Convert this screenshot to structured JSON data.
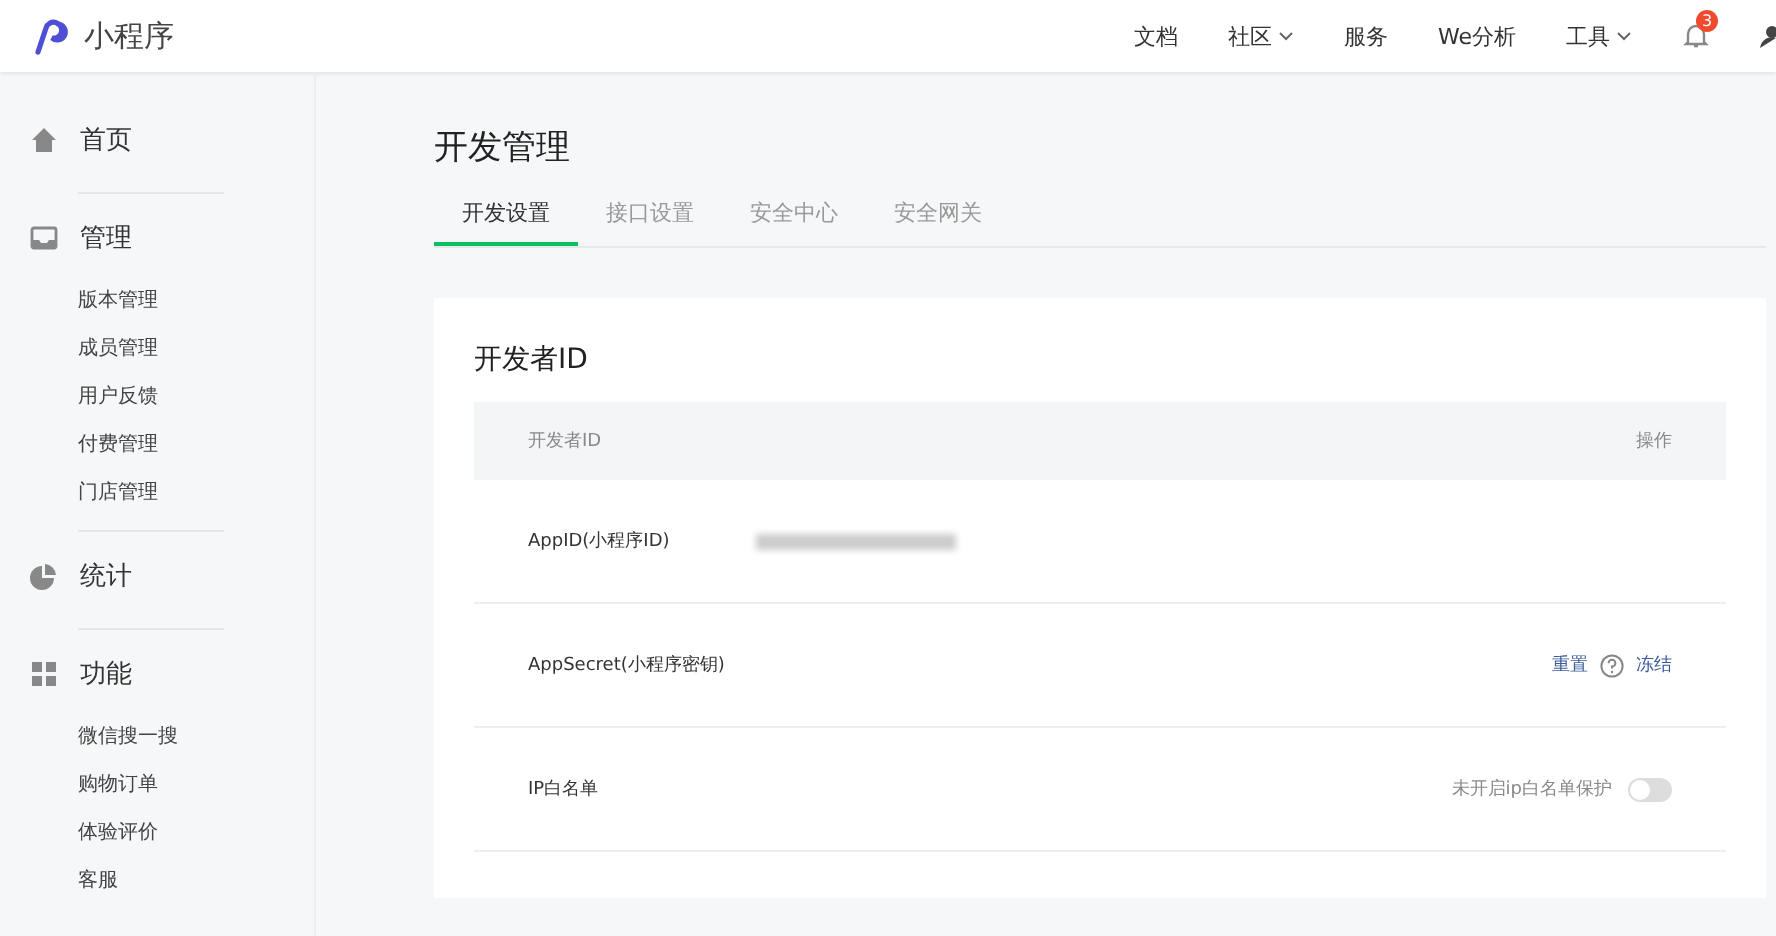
{
  "header": {
    "logo": "小程序",
    "nav": [
      {
        "label": "文档",
        "dropdown": false
      },
      {
        "label": "社区",
        "dropdown": true
      },
      {
        "label": "服务",
        "dropdown": false
      },
      {
        "label": "We分析",
        "dropdown": false
      },
      {
        "label": "工具",
        "dropdown": true
      }
    ],
    "notification_count": "3"
  },
  "sidebar": [
    {
      "title": "首页"
    },
    {
      "title": "管理",
      "children": [
        "版本管理",
        "成员管理",
        "用户反馈",
        "付费管理",
        "门店管理"
      ]
    },
    {
      "title": "统计"
    },
    {
      "title": "功能",
      "children": [
        "微信搜一搜",
        "购物订单",
        "体验评价",
        "客服"
      ]
    }
  ],
  "page": {
    "title": "开发管理",
    "tabs": [
      {
        "label": "开发设置",
        "selected": true
      },
      {
        "label": "接口设置",
        "selected": false
      },
      {
        "label": "安全中心",
        "selected": false
      },
      {
        "label": "安全网关",
        "selected": false
      }
    ]
  },
  "card": {
    "title": "开发者ID",
    "columns": [
      "开发者ID",
      "操作"
    ],
    "rows": [
      {
        "kind": "value",
        "label": "AppID(小程序ID)"
      },
      {
        "kind": "actions",
        "label": "AppSecret(小程序密钥)",
        "actions": [
          "重置",
          "冻结"
        ]
      },
      {
        "kind": "toggle",
        "label": "IP白名单",
        "status": "未开启ip白名单保护",
        "on": false
      }
    ]
  }
}
